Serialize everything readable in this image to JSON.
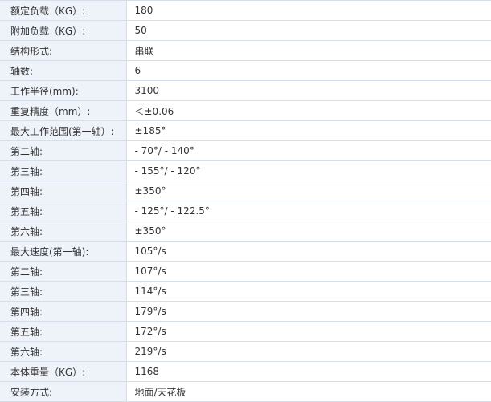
{
  "spec_table": {
    "rows": [
      {
        "label": "额定负载（KG）:",
        "value": "180"
      },
      {
        "label": "附加负载（KG）:",
        "value": "50"
      },
      {
        "label": "结构形式:",
        "value": "串联"
      },
      {
        "label": "轴数:",
        "value": "6"
      },
      {
        "label": "工作半径(mm):",
        "value": "3100"
      },
      {
        "label": "重复精度（mm）:",
        "value": "＜±0.06"
      },
      {
        "label": "最大工作范围(第一轴）:",
        "value": "±185°"
      },
      {
        "label": "第二轴:",
        "value": "- 70°/ - 140°"
      },
      {
        "label": "第三轴:",
        "value": "- 155°/ - 120°"
      },
      {
        "label": "第四轴:",
        "value": "±350°"
      },
      {
        "label": "第五轴:",
        "value": "- 125°/ - 122.5°"
      },
      {
        "label": "第六轴:",
        "value": "±350°"
      },
      {
        "label": "最大速度(第一轴):",
        "value": "105°/s"
      },
      {
        "label": "第二轴:",
        "value": "107°/s"
      },
      {
        "label": "第三轴:",
        "value": "114°/s"
      },
      {
        "label": "第四轴:",
        "value": "179°/s"
      },
      {
        "label": "第五轴:",
        "value": "172°/s"
      },
      {
        "label": "第六轴:",
        "value": "219°/s"
      },
      {
        "label": "本体重量（KG）:",
        "value": "1168"
      },
      {
        "label": "安装方式:",
        "value": "地面/天花板"
      }
    ]
  }
}
